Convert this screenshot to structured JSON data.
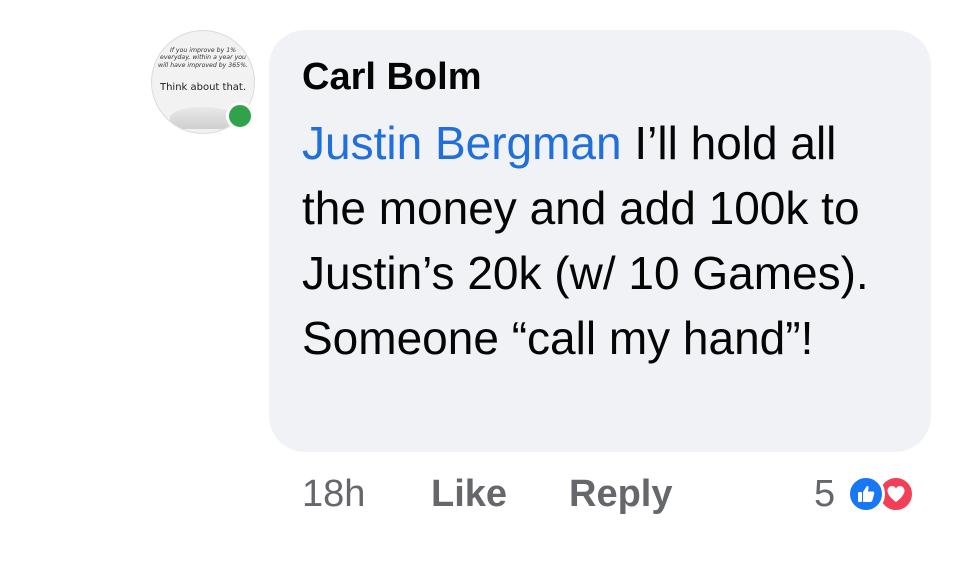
{
  "avatar": {
    "quote_line1": "If you improve by 1%",
    "quote_line2": "everyday, within a year you",
    "quote_line3": "will have improved by 365%.",
    "tagline": "Think about that."
  },
  "comment": {
    "author": "Carl Bolm",
    "mention": "Justin Bergman",
    "text": " I’ll hold all the money and add 100k to Justin’s 20k (w/ 10 Games). Someone “call my hand”!"
  },
  "actions": {
    "timestamp": "18h",
    "like_label": "Like",
    "reply_label": "Reply",
    "reaction_count": "5",
    "reactions": [
      "like-reaction",
      "love-reaction"
    ]
  },
  "colors": {
    "bubble": "#f0f2f5",
    "mention": "#216fdb",
    "online": "#31a24c",
    "like": "#1877f2",
    "love": "#f33e58",
    "muted": "#65676b"
  }
}
